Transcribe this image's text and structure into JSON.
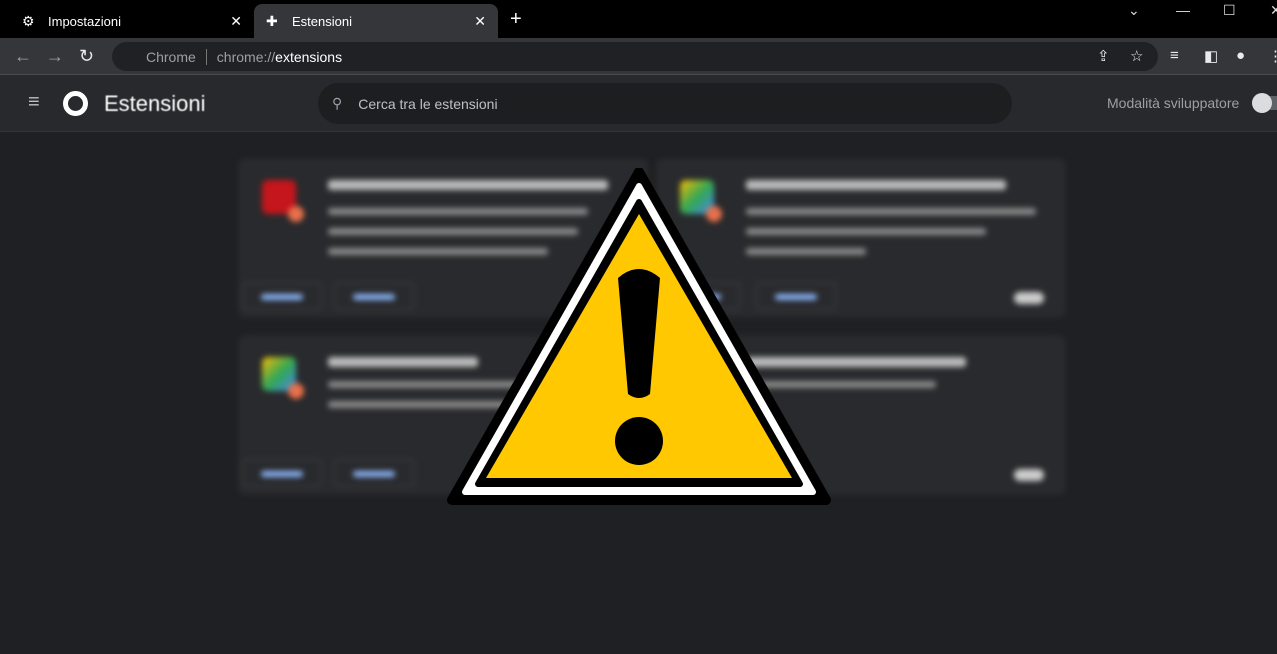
{
  "tabs": [
    {
      "label": "Impostazioni",
      "icon": "gear-icon",
      "active": false
    },
    {
      "label": "Estensioni",
      "icon": "puzzle-icon",
      "active": true
    }
  ],
  "toolbar": {
    "site_label": "Chrome",
    "url_prefix": "chrome://",
    "url_path": "extensions"
  },
  "header": {
    "title": "Estensioni",
    "search_placeholder": "Cerca tra le estensioni",
    "dev_mode_label": "Modalità sviluppatore",
    "dev_mode_on": false
  },
  "colors": {
    "warning_fill": "#ffc800",
    "background": "#1f2023"
  },
  "overlay": {
    "icon": "warning-triangle-icon"
  }
}
